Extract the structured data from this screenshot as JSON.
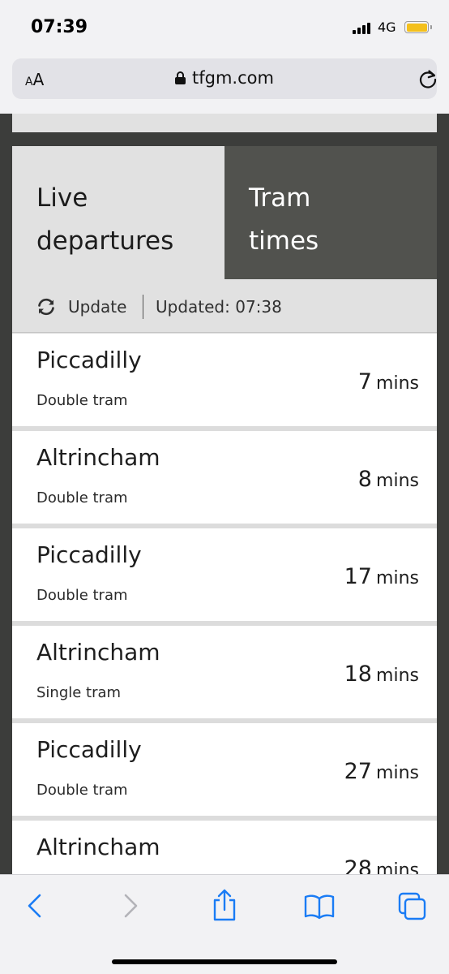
{
  "status_bar": {
    "time": "07:39",
    "network": "4G",
    "battery_color": "#f4c01c"
  },
  "browser": {
    "text_size_small": "A",
    "text_size_big": "A",
    "url": "tfgm.com"
  },
  "tabs": [
    {
      "label": "Live\ndepartures",
      "selected": true
    },
    {
      "label": "Tram\ntimes",
      "selected": false
    }
  ],
  "update": {
    "button_label": "Update",
    "updated_text": "Updated: 07:38"
  },
  "departures": [
    {
      "destination": "Piccadilly",
      "type": "Double tram",
      "minutes": "7",
      "unit": "mins"
    },
    {
      "destination": "Altrincham",
      "type": "Double tram",
      "minutes": "8",
      "unit": "mins"
    },
    {
      "destination": "Piccadilly",
      "type": "Double tram",
      "minutes": "17",
      "unit": "mins"
    },
    {
      "destination": "Altrincham",
      "type": "Single tram",
      "minutes": "18",
      "unit": "mins"
    },
    {
      "destination": "Piccadilly",
      "type": "Double tram",
      "minutes": "27",
      "unit": "mins"
    },
    {
      "destination": "Altrincham",
      "type": "",
      "minutes": "28",
      "unit": "mins"
    }
  ],
  "colors": {
    "accent_blue": "#1a7cf5",
    "tab_dark": "#51524e",
    "tab_light": "#e1e1e1",
    "page_background": "#3c3d3b"
  },
  "toolbar": {
    "icons": [
      "back-icon",
      "forward-icon",
      "share-icon",
      "bookmarks-icon",
      "tabs-icon"
    ]
  }
}
